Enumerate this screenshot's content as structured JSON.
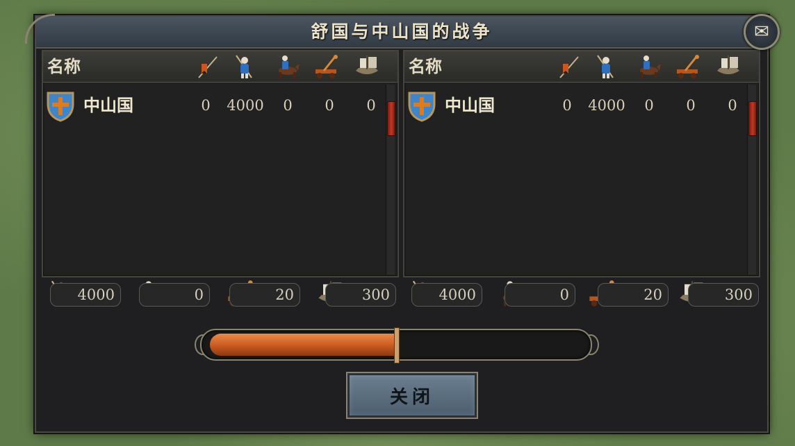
{
  "window": {
    "title": "舒国与中山国的战争"
  },
  "mail_icon": "envelope-icon",
  "columns": {
    "name_label": "名称",
    "unit_icons": [
      "banner-icon",
      "spearman-icon",
      "cavalry-icon",
      "catapult-icon",
      "ship-icon"
    ]
  },
  "left_side": {
    "rows": [
      {
        "crest": "shield-crest-icon",
        "name": "中山国",
        "values": [
          "0",
          "4000",
          "0",
          "0",
          "0"
        ]
      }
    ],
    "totals": [
      {
        "icon": "spearman-icon",
        "value": "4000"
      },
      {
        "icon": "cavalry-icon",
        "value": "0"
      },
      {
        "icon": "catapult-icon",
        "value": "20"
      },
      {
        "icon": "ship-icon",
        "value": "300"
      }
    ]
  },
  "right_side": {
    "rows": [
      {
        "crest": "shield-crest-icon",
        "name": "中山国",
        "values": [
          "0",
          "4000",
          "0",
          "0",
          "0"
        ]
      }
    ],
    "totals": [
      {
        "icon": "spearman-icon",
        "value": "4000"
      },
      {
        "icon": "cavalry-icon",
        "value": "0"
      },
      {
        "icon": "catapult-icon",
        "value": "20"
      },
      {
        "icon": "ship-icon",
        "value": "300"
      }
    ]
  },
  "balance_bar": {
    "left_share": 0.5
  },
  "colors": {
    "bar_fill": "#c85a20",
    "button": "#5d7082",
    "scroll_thumb": "#c33a22"
  },
  "close_button": {
    "label": "关闭"
  }
}
